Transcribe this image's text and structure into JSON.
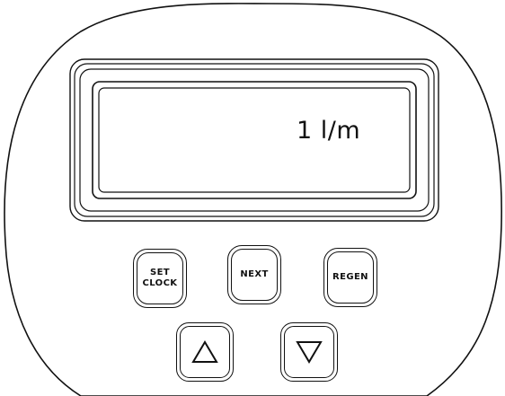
{
  "display": {
    "reading": "1 l/m"
  },
  "buttons": {
    "set_clock_line1": "SET",
    "set_clock_line2": "CLOCK",
    "next": "NEXT",
    "regen": "REGEN"
  },
  "icons": {
    "up": "up-triangle-icon",
    "down": "down-triangle-icon"
  },
  "colors": {
    "outline": "#111111",
    "background": "#ffffff"
  }
}
